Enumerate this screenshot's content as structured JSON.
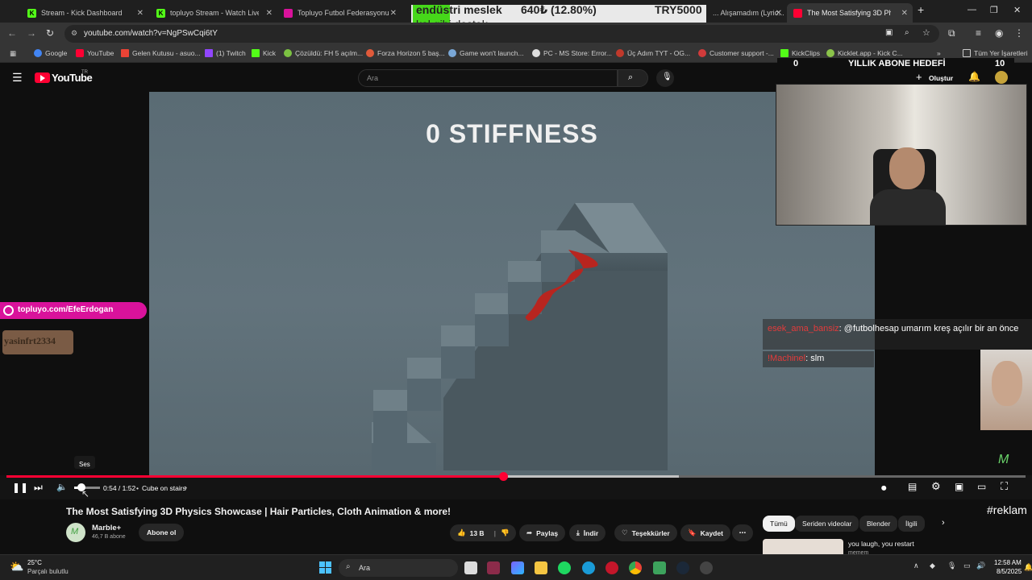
{
  "tabs": [
    {
      "title": "Stream - Kick Dashboard",
      "icon": "kick-icon"
    },
    {
      "title": "topluyo Stream - Watch Live on",
      "icon": "kick-icon"
    },
    {
      "title": "Topluyo Futbol Federasyonu",
      "icon": "topluyo-icon"
    },
    {
      "title": "... Alışamadım (Lyric...",
      "icon": "youtube-icon"
    },
    {
      "title": "The Most Satisfying 3D Ph...",
      "icon": "youtube-icon"
    }
  ],
  "address_bar": {
    "url": "youtube.com/watch?v=NgPSwCqi6tY"
  },
  "bookmarks": [
    "Google",
    "YouTube",
    "Gelen Kutusu - asuo...",
    "(1) Twitch",
    "Kick",
    "Çözüldü: FH 5 açılm...",
    "Forza Horizon 5 baş...",
    "Game won't launch...",
    "PC - MS Store: Error...",
    "Üç Adım TYT - OG...",
    "Customer support -...",
    "KickClips",
    "Kicklet.app - Kick C...",
    "Tüm Yer İşaretleri"
  ],
  "yt_header": {
    "logo": "YouTube",
    "logo_region": "TR",
    "search_placeholder": "Ara",
    "create_label": "Oluştur"
  },
  "video": {
    "overlay_title": "0 STIFFNESS",
    "time": "0:54 / 1:52",
    "chapter": "Cube on stairs",
    "tooltip": "Ses",
    "progress_fraction": 0.487,
    "buffer_fraction": 0.66
  },
  "stream_overlay": {
    "top_banner_line1": "endüstri meslek",
    "top_banner_amount": "640₺ (12.80%)",
    "top_banner_goal": "TRY5000",
    "top_banner_line2": "kol gibi destek",
    "sub_goal_left": "0",
    "sub_goal_title": "YILLIK ABONE HEDEFİ",
    "sub_goal_right": "10",
    "channel_badge": "topluyo.com/EfeErdogan",
    "tag_name": "yasinfrt2334",
    "chat": [
      {
        "user": "esek_ama_bansiz",
        "text": ": @futbolhesap umarım kreş açılır bir an önce"
      },
      {
        "user": "!Machinel",
        "text": ": slm"
      }
    ],
    "reklam": "#reklam"
  },
  "below_video": {
    "title": "The Most Satisfying 3D Physics Showcase | Hair Particles, Cloth Animation & more!",
    "channel": "Marble+",
    "subscribers": "46,7 B abone",
    "subscribe": "Abone ol",
    "likes": "13 B",
    "share": "Paylaş",
    "download": "İndir",
    "thanks": "Teşekkürler",
    "save": "Kaydet",
    "chips": [
      "Tümü",
      "Seriden videolar",
      "Blender",
      "İlgili"
    ],
    "next_video_title": "you laugh, you restart",
    "next_video_channel": "memem"
  },
  "taskbar": {
    "weather_temp": "25°C",
    "weather_desc": "Parçalı bulutlu",
    "search": "Ara",
    "time": "12:58 AM",
    "date": "8/5/2025"
  },
  "colors": {
    "youtube_red": "#ff0033",
    "kick_green": "#53fc18",
    "topluyo_magenta": "#d9129b",
    "yt_bg": "#0f0f0f"
  }
}
